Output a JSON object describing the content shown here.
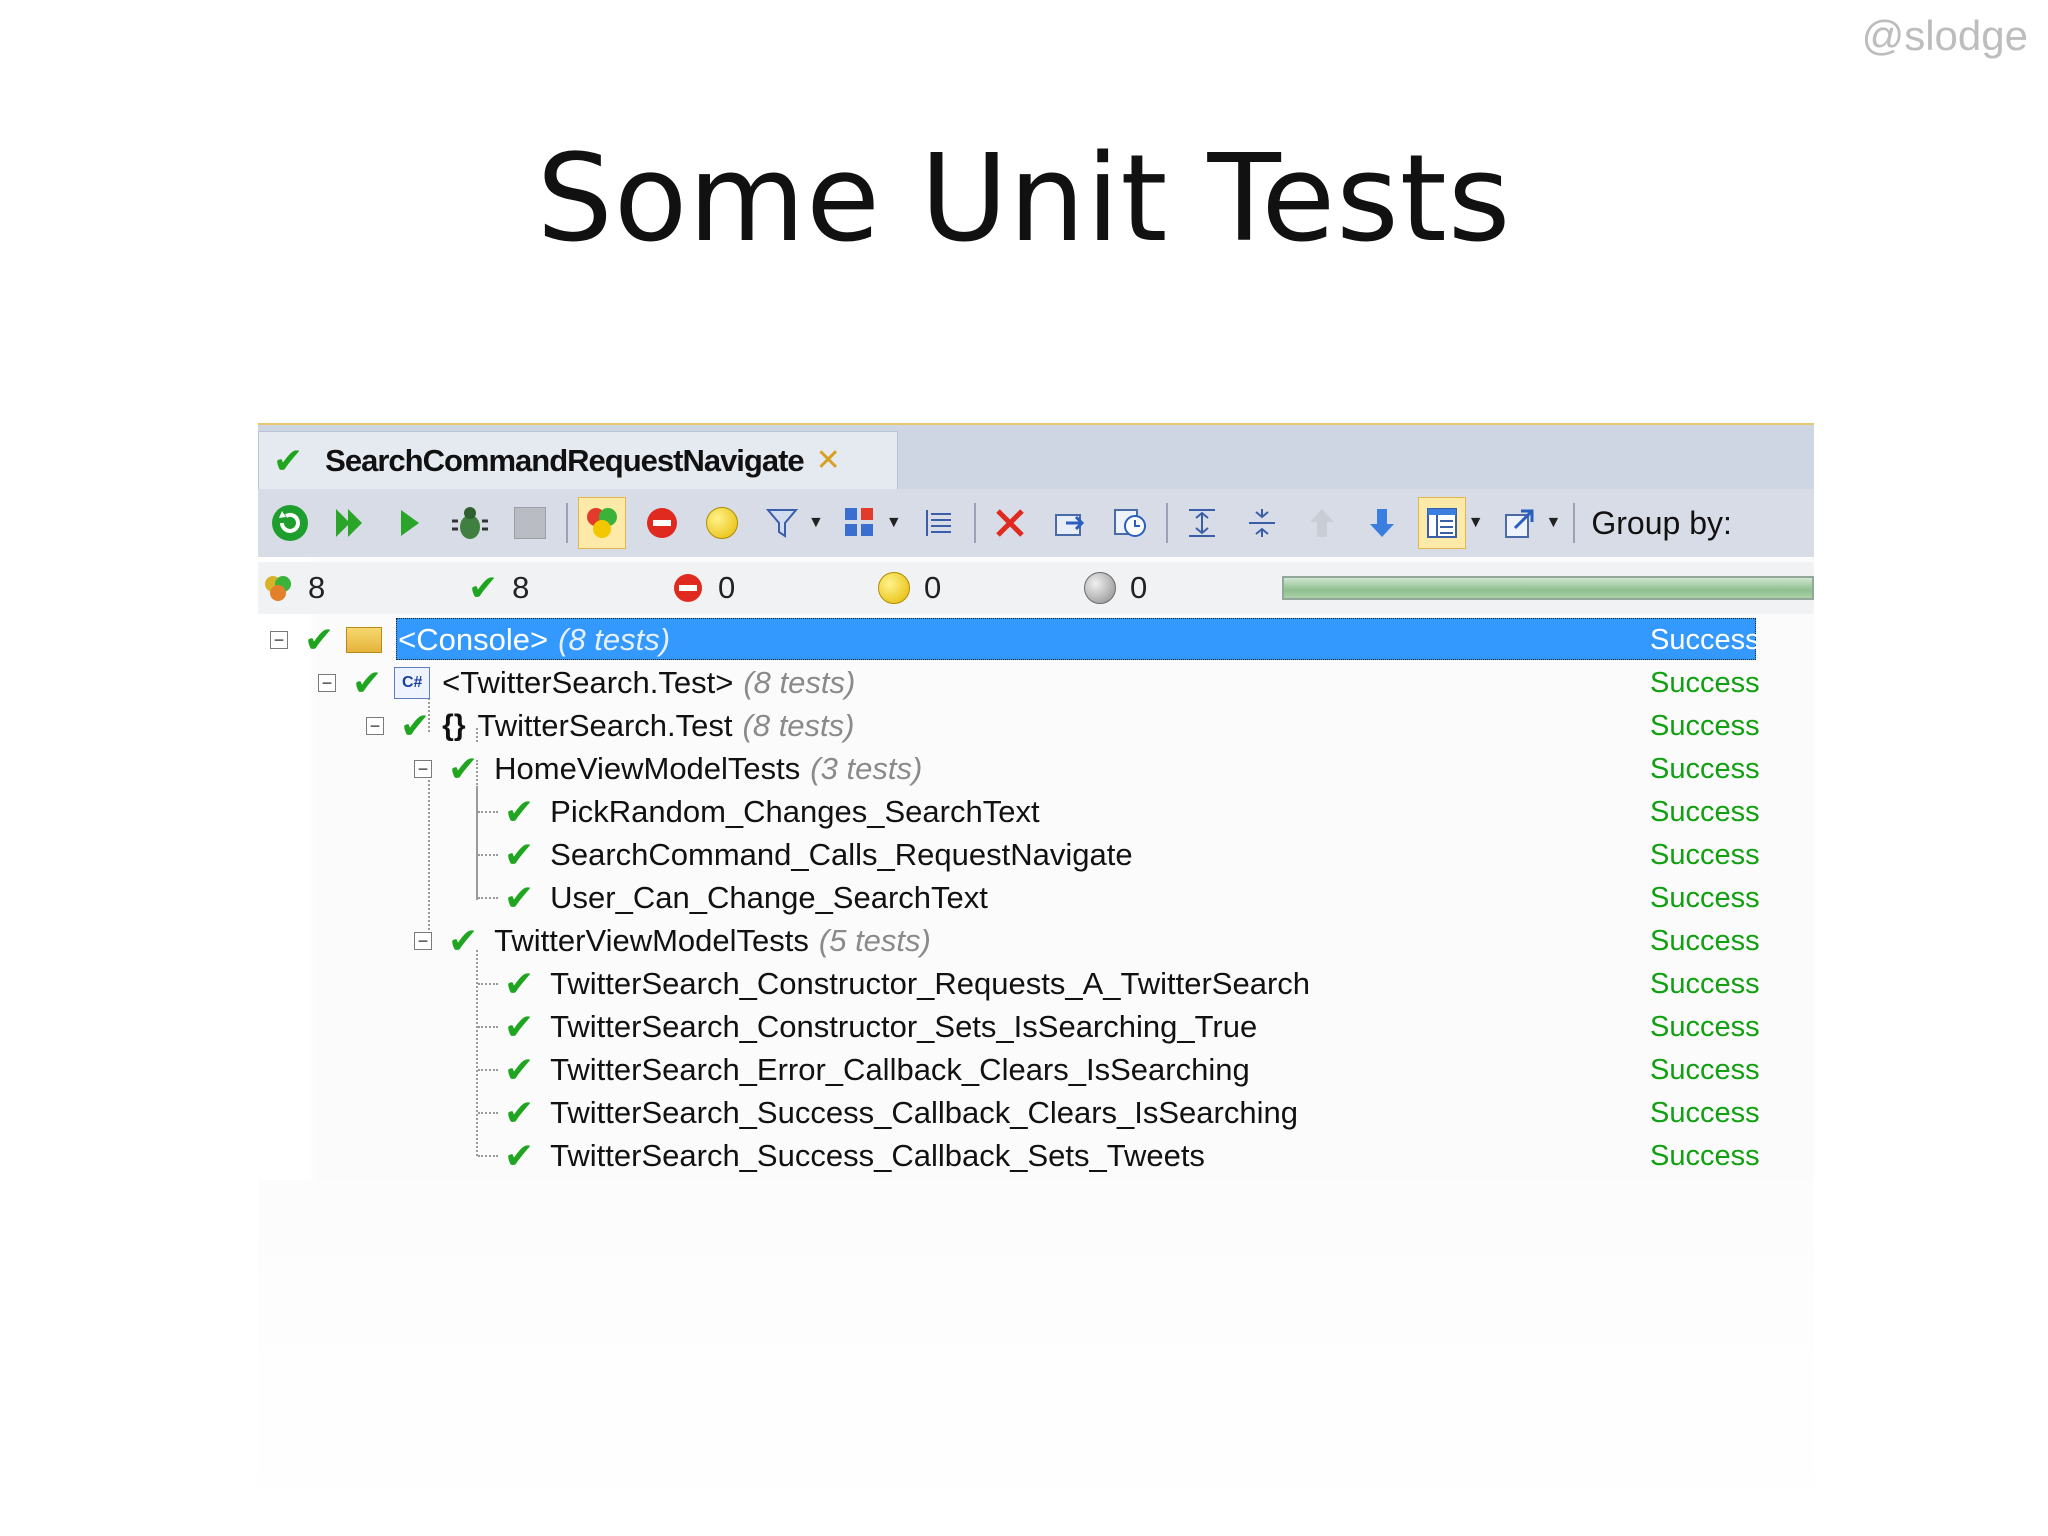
{
  "watermark": "@slodge",
  "slide_title": "Some Unit Tests",
  "tab": {
    "title": "SearchCommandRequestNavigate"
  },
  "toolbar": {
    "group_by_label": "Group by:"
  },
  "status": {
    "total": "8",
    "passed": "8",
    "failed": "0",
    "inconclusive": "0",
    "not_run": "0",
    "progress_fraction": 1.0
  },
  "tree": {
    "console": {
      "label": "<Console>",
      "count": "(8 tests)",
      "status": "Success"
    },
    "project": {
      "label": "<TwitterSearch.Test>",
      "count": "(8 tests)",
      "status": "Success"
    },
    "namespace": {
      "label": "TwitterSearch.Test",
      "count": "(8 tests)",
      "status": "Success"
    },
    "fixture1": {
      "label": "HomeViewModelTests",
      "count": "(3 tests)",
      "status": "Success"
    },
    "fixture1_tests": [
      {
        "label": "PickRandom_Changes_SearchText",
        "status": "Success"
      },
      {
        "label": "SearchCommand_Calls_RequestNavigate",
        "status": "Success"
      },
      {
        "label": "User_Can_Change_SearchText",
        "status": "Success"
      }
    ],
    "fixture2": {
      "label": "TwitterViewModelTests",
      "count": "(5 tests)",
      "status": "Success"
    },
    "fixture2_tests": [
      {
        "label": "TwitterSearch_Constructor_Requests_A_TwitterSearch",
        "status": "Success"
      },
      {
        "label": "TwitterSearch_Constructor_Sets_IsSearching_True",
        "status": "Success"
      },
      {
        "label": "TwitterSearch_Error_Callback_Clears_IsSearching",
        "status": "Success"
      },
      {
        "label": "TwitterSearch_Success_Callback_Clears_IsSearching",
        "status": "Success"
      },
      {
        "label": "TwitterSearch_Success_Callback_Sets_Tweets",
        "status": "Success"
      }
    ]
  },
  "colors": {
    "success": "#12a012",
    "selection": "#3399ff",
    "check": "#1fa51f"
  }
}
